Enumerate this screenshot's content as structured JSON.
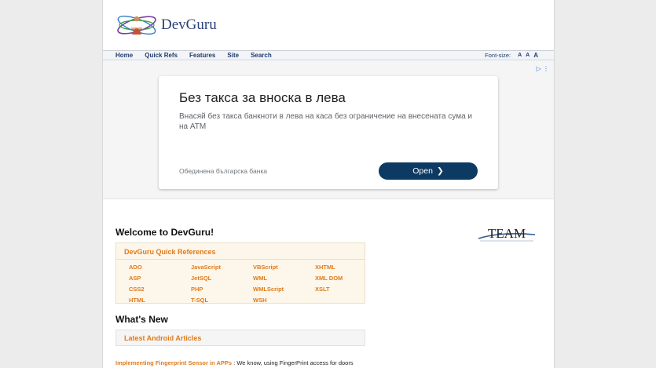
{
  "header": {
    "logo_text": "DevGuru"
  },
  "nav": {
    "links": [
      "Home",
      "Quick Refs",
      "Features",
      "Site",
      "Search"
    ],
    "font_size_label": "Font-size:",
    "font_size_options": [
      "A",
      "A",
      "A"
    ]
  },
  "ad": {
    "title": "Без такса за вноска в лева",
    "body": "Внасяй без такса банкноти в лева на каса без ограничение на внесената сума и на АТМ",
    "advertiser": "Обединена българска банка",
    "cta": "Open",
    "adchoices_icon": "play-triangle-icon"
  },
  "welcome": {
    "heading": "Welcome to DevGuru!"
  },
  "quick_refs": {
    "title": "DevGuru Quick References",
    "columns": [
      [
        "ADO",
        "ASP",
        "CSS2",
        "HTML"
      ],
      [
        "JavaScript",
        "JetSQL",
        "PHP",
        "T-SQL"
      ],
      [
        "VBScript",
        "WML",
        "WMLScript",
        "WSH"
      ],
      [
        "XHTML",
        "XML DOM",
        "XSLT"
      ]
    ]
  },
  "whats_new": {
    "heading": "What's New",
    "box_title": "Latest Android Articles",
    "article_title": "Implementing Fingerprint Sensor in APPs",
    "article_snippet": " : We know, using FingerPrint access for doors"
  },
  "sidebar": {
    "team_logo_text": "TEAM"
  },
  "colors": {
    "accent": "#e07b1a",
    "nav_text": "#1f3c6e",
    "cta_bg": "#0d3a63"
  }
}
